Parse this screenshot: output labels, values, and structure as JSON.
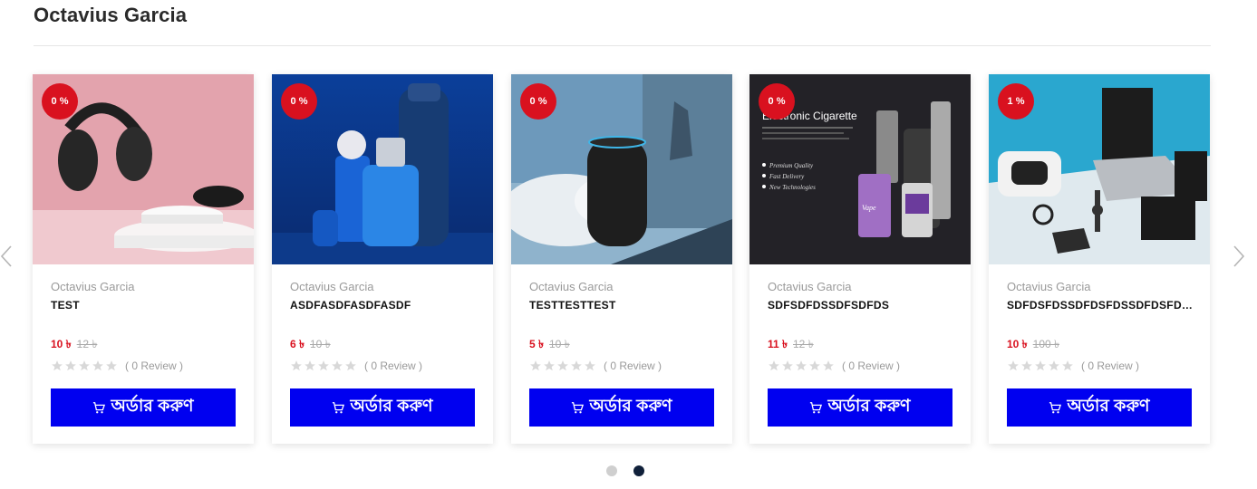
{
  "section": {
    "title": "Octavius Garcia"
  },
  "products": [
    {
      "discount": "0 %",
      "vendor": "Octavius Garcia",
      "name": "TEST",
      "price": "10 ৳",
      "old_price": "12 ৳",
      "review": "( 0 Review )",
      "button": "অর্ডার করুণ",
      "image": "headphones"
    },
    {
      "discount": "0 %",
      "vendor": "Octavius Garcia",
      "name": "ASDFASDFASDFASDF",
      "price": "6 ৳",
      "old_price": "10 ৳",
      "review": "( 0 Review )",
      "button": "অর্ডার করুণ",
      "image": "cosmetics"
    },
    {
      "discount": "0 %",
      "vendor": "Octavius Garcia",
      "name": "TESTTESTTEST",
      "price": "5 ৳",
      "old_price": "10 ৳",
      "review": "( 0 Review )",
      "button": "অর্ডার করুণ",
      "image": "smart-speaker"
    },
    {
      "discount": "0 %",
      "vendor": "Octavius Garcia",
      "name": "SDFSDFDSSDFSDFDS",
      "price": "11 ৳",
      "old_price": "12 ৳",
      "review": "( 0 Review )",
      "button": "অর্ডার করুণ",
      "image": "e-cigarette",
      "image_text": {
        "heading": "Electronic Cigarette",
        "bullets": [
          "Premium Quality",
          "Fast Delivery",
          "New Technologies"
        ],
        "label": "Vape"
      }
    },
    {
      "discount": "1 %",
      "vendor": "Octavius Garcia",
      "name": "SDFDSFDSSDFDSFDSSDFDSFDSSDFDSF",
      "price": "10 ৳",
      "old_price": "100 ৳",
      "review": "( 0 Review )",
      "button": "অর্ডার করুণ",
      "image": "gadgets-desk"
    }
  ],
  "icons": {
    "prev": "chevron-left-icon",
    "next": "chevron-right-icon",
    "star": "star-icon",
    "cart": "cart-icon"
  },
  "carousel": {
    "pages": 2,
    "active_page": 2
  },
  "colors": {
    "accent_button": "#0000f0",
    "badge": "#d9111f",
    "price": "#d9111f"
  }
}
